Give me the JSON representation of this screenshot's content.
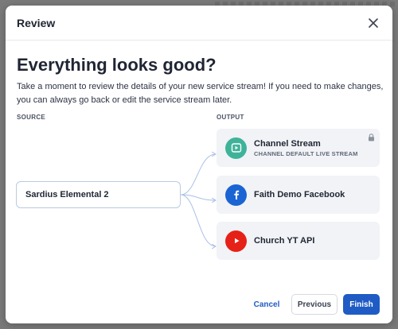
{
  "modal": {
    "title": "Review",
    "headline": "Everything looks good?",
    "description": "Take a moment to review the details of your new service stream! If you need to make changes, you can always go back or edit the service stream later."
  },
  "columns": {
    "source_label": "SOURCE",
    "output_label": "OUTPUT"
  },
  "source": {
    "name": "Sardius Elemental 2"
  },
  "outputs": [
    {
      "name": "Channel Stream",
      "subtitle": "CHANNEL DEFAULT LIVE STREAM",
      "icon": "play-square-icon",
      "color": "#3fb39a",
      "locked": true
    },
    {
      "name": "Faith Demo Facebook",
      "subtitle": "",
      "icon": "facebook-icon",
      "color": "#1b64d4",
      "locked": false
    },
    {
      "name": "Church YT API",
      "subtitle": "",
      "icon": "youtube-icon",
      "color": "#e62117",
      "locked": false
    }
  ],
  "footer": {
    "cancel_label": "Cancel",
    "previous_label": "Previous",
    "finish_label": "Finish"
  },
  "colors": {
    "accent": "#1f5bc4",
    "connector": "#a9c0e6"
  }
}
